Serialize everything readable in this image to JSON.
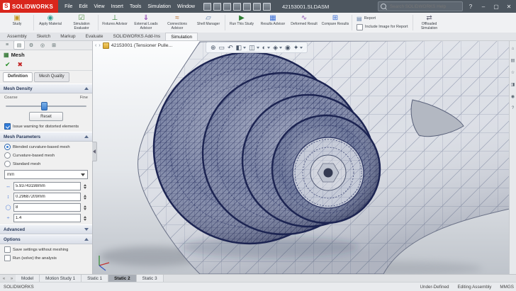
{
  "colors": {
    "accent_blue": "#2f7bd9",
    "solidworks_red": "#d9261c",
    "mesh_navy": "#242d5e",
    "part_gray": "#dcdfe6"
  },
  "titlebar": {
    "logo_text": "SOLIDWORKS",
    "menus": [
      "File",
      "Edit",
      "View",
      "Insert",
      "Tools",
      "Simulation",
      "Window"
    ],
    "doc_title": "42153001.SLDASM",
    "search_placeholder": "Search SOLIDWORKS Help",
    "window": {
      "help": "?",
      "minimize": "–",
      "maximize": "▢",
      "close": "✕"
    }
  },
  "ribbon": {
    "tabs": [
      "Assembly",
      "Sketch",
      "Markup",
      "Evaluate",
      "SOLIDWORKS Add-Ins",
      "Simulation"
    ],
    "active_tab": "Simulation",
    "buttons": [
      {
        "label": "Study",
        "glyph": "▣"
      },
      {
        "label": "Apply Material",
        "glyph": "◉"
      },
      {
        "label": "Simulation Evaluator",
        "glyph": "☑"
      },
      {
        "label": "Fixtures Advisor",
        "glyph": "⊥"
      },
      {
        "label": "External Loads Advisor",
        "glyph": "⇓"
      },
      {
        "label": "Connections Advisor",
        "glyph": "≈"
      },
      {
        "label": "Shell Manager",
        "glyph": "▱"
      },
      {
        "label": "Run This Study",
        "glyph": "▶"
      },
      {
        "label": "Results Advisor",
        "glyph": "▦"
      },
      {
        "label": "Deformed Result",
        "glyph": "∿"
      },
      {
        "label": "Compare Results",
        "glyph": "⊞"
      },
      {
        "label": "Offloaded Simulation",
        "glyph": "⇄"
      }
    ],
    "report": {
      "label": "Report",
      "glyph": "▤"
    },
    "include_image": {
      "label": "Include Image for Report",
      "checked": false
    }
  },
  "pm": {
    "tab_icons": [
      "≡",
      "▤",
      "⚙",
      "◎",
      "⊞"
    ],
    "title": "Mesh",
    "ok_glyph": "✔",
    "cancel_glyph": "✖",
    "tabs": [
      "Definition",
      "Mesh Quality"
    ],
    "active_tab": "Definition",
    "mesh_density": {
      "label": "Mesh Density",
      "coarse": "Coarse",
      "fine": "Fine",
      "reset": "Reset",
      "slider_position": "44%",
      "warning": {
        "label": "Issue warning for distorted elements",
        "checked": true
      }
    },
    "mesh_parameters": {
      "label": "Mesh Parameters",
      "options": [
        {
          "label": "Blended curvature-based mesh",
          "selected": true
        },
        {
          "label": "Curvature-based mesh",
          "selected": false
        },
        {
          "label": "Standard mesh",
          "selected": false
        }
      ],
      "unit": "mm",
      "max_element_size": "5.93743198mm",
      "min_element_size": "0.29687209mm",
      "min_elements_in_circle": "8",
      "growth_ratio": "1.4"
    },
    "advanced_label": "Advanced",
    "options": {
      "label": "Options",
      "items": [
        {
          "label": "Save settings without meshing",
          "checked": false
        },
        {
          "label": "Run (solve) the analysis",
          "checked": false
        }
      ]
    }
  },
  "viewport": {
    "breadcrumb": "42153001 (Tensioner Pulle...",
    "hud_icons": [
      "⊕",
      "▭",
      "↶",
      "◧",
      "◫",
      "◐",
      "◈",
      "◉",
      "✦"
    ]
  },
  "taskpane_icons": [
    "⌂",
    "▤",
    "☆",
    "◨",
    "◉",
    "?"
  ],
  "doc_tabs": {
    "items": [
      "Model",
      "Motion Study 1",
      "Static 1",
      "Static 2",
      "Static 3"
    ],
    "active": "Static 2"
  },
  "statusbar": {
    "left": "SOLIDWORKS",
    "items": [
      "Under-Defined",
      "Editing Assembly",
      "MMGS"
    ]
  }
}
